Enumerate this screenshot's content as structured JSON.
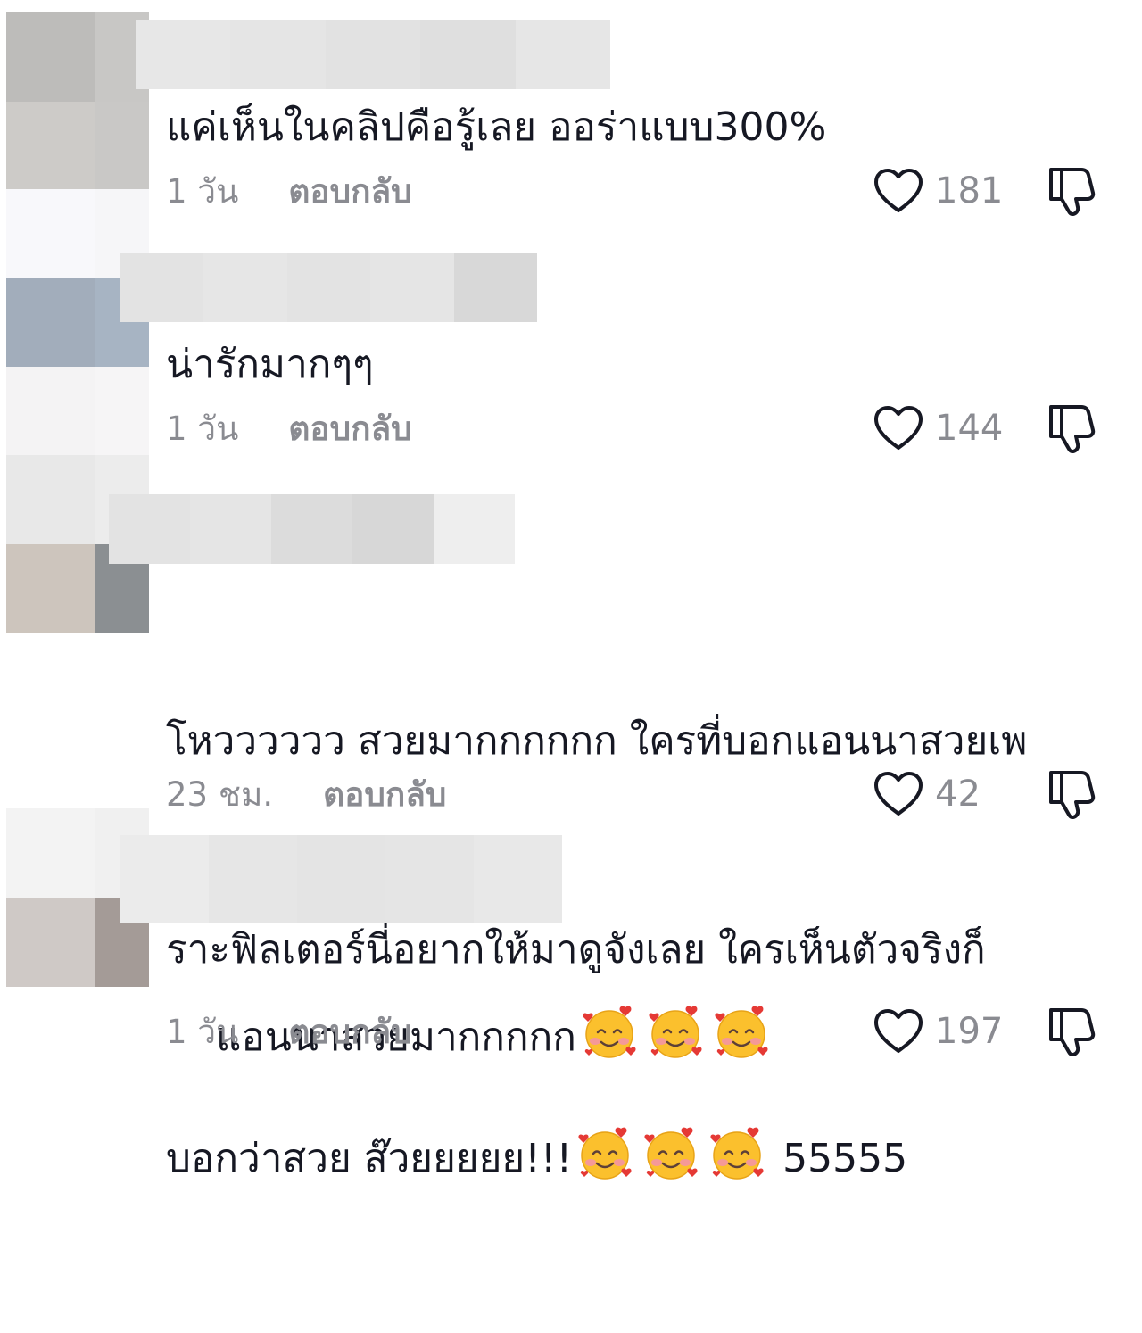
{
  "comments": [
    {
      "text": "แค่เห็นในคลิปคือรู้เลย ออร่าแบบ300%",
      "time": "1 วัน",
      "reply_label": "ตอบกลับ",
      "likes": "181",
      "emoji_count": 0
    },
    {
      "text": "น่ารักมากๆๆ",
      "time": "1 วัน",
      "reply_label": "ตอบกลับ",
      "likes": "144",
      "emoji_count": 0
    },
    {
      "text_lines": [
        "โหวววววว สวยมากกกกกก ใครที่บอกแอนนาสวยเพ",
        "ราะฟิลเตอร์นี่อยากให้มาดูจังเลย ใครเห็นตัวจริงก็",
        "บอกว่าสวย ส๊วยยยยย!!!"
      ],
      "text_tail": "55555",
      "time": "23 ชม.",
      "reply_label": "ตอบกลับ",
      "likes": "42",
      "emoji_count": 3,
      "emoji_name": "smiling-face-with-hearts"
    },
    {
      "text": "แอนนาสวยมากกกกก",
      "time": "1 วัน",
      "reply_label": "ตอบกลับ",
      "likes": "197",
      "emoji_count": 3,
      "emoji_name": "smiling-face-with-hearts"
    }
  ],
  "icons": {
    "like": "heart-outline-icon",
    "dislike": "thumbs-down-outline-icon"
  },
  "colors": {
    "text": "#161823",
    "muted": "#8a8b91",
    "icon": "#161823"
  }
}
